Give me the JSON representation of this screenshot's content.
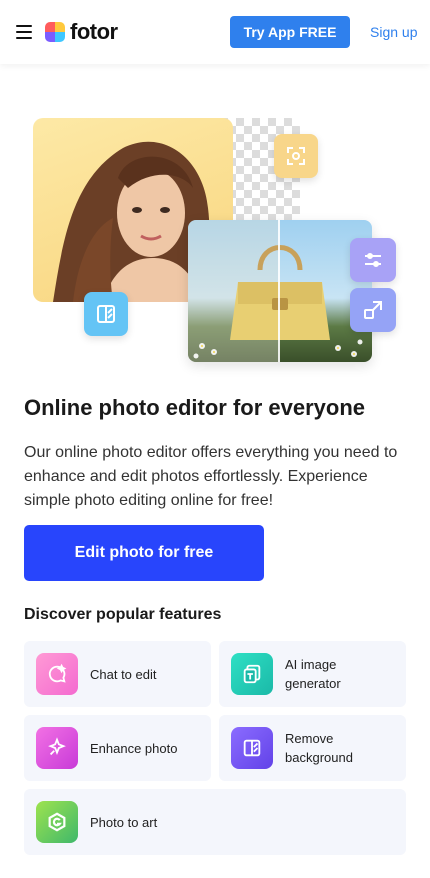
{
  "header": {
    "menu_icon": "hamburger-menu-icon",
    "logo_text": "fotor",
    "logo_colors": [
      "#ff5c5c",
      "#ffc93c",
      "#3ec7ff",
      "#7b5cff"
    ],
    "try_app_label": "Try App FREE",
    "signup_label": "Sign up",
    "accent": "#2f80ed"
  },
  "hero": {
    "tiles": [
      "crop-focus-icon",
      "compare-icon",
      "sliders-icon",
      "resize-icon"
    ]
  },
  "main": {
    "headline": "Online photo editor for everyone",
    "description": "Our online photo editor offers everything you need to enhance and edit photos effortlessly. Experience simple photo editing online for free!",
    "cta_label": "Edit photo for free",
    "cta_color": "#2845fc",
    "discover_title": "Discover popular features"
  },
  "features": [
    {
      "label": "Chat to edit",
      "icon": "chat-edit-icon"
    },
    {
      "label": "AI image generator",
      "icon": "ai-image-icon"
    },
    {
      "label": "Enhance photo",
      "icon": "enhance-sparkle-icon"
    },
    {
      "label": "Remove background",
      "icon": "remove-bg-icon"
    },
    {
      "label": "Photo to art",
      "icon": "photo-art-icon"
    }
  ]
}
